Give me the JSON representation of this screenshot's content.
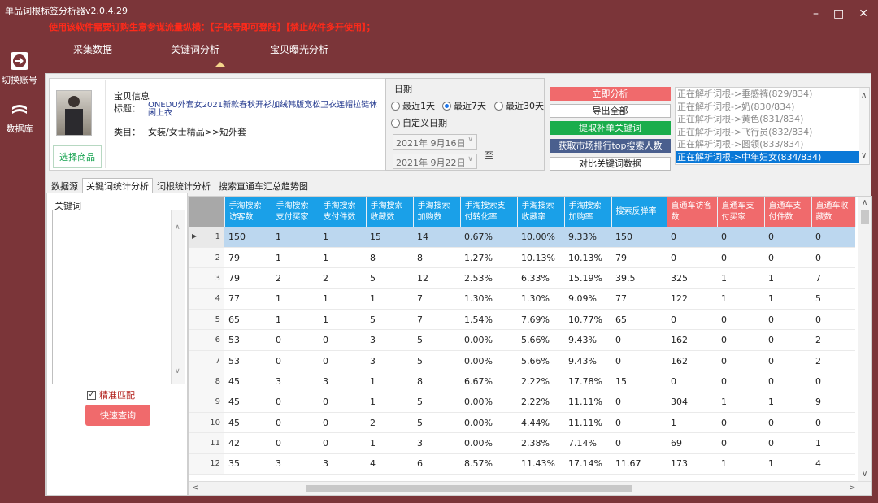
{
  "window": {
    "title": "单品词根标签分析器v2.0.4.29",
    "notice": "使用该软件需要订购生意参谋流量纵横：【子账号即可登陆】【禁止软件多开使用】；",
    "minimize": "–",
    "maximize": "□",
    "close": "✕"
  },
  "leftnav": {
    "switch_account": "切换账号",
    "database": "数据库"
  },
  "topnav": {
    "tabs": [
      "采集数据",
      "关键词分析",
      "宝贝曝光分析"
    ],
    "active": "关键词分析"
  },
  "product": {
    "section_title": "宝贝信息",
    "title_label": "标题：",
    "title_value": "ONEDU外套女2021新款春秋开衫加绒韩版宽松卫衣连帽拉链休闲上衣",
    "category_label": "类目：",
    "category_value": "女装/女士精品>>短外套",
    "pick_button": "选择商品"
  },
  "date": {
    "title": "日期",
    "options": [
      "最近1天",
      "最近7天",
      "最近30天"
    ],
    "selected": "最近7天",
    "custom": "自定义日期",
    "start": "2021年 9月16日",
    "end": "2021年 9月22日",
    "to": "至"
  },
  "actions": {
    "analyze": "立即分析",
    "export_all": "导出全部",
    "extract": "提取补单关键词",
    "market_rank": "获取市场排行top搜索人数",
    "compare": "对比关键词数据"
  },
  "log": {
    "lines": [
      "正在解析词根->垂感裤(829/834)",
      "正在解析词根->奶(830/834)",
      "正在解析词根->黄色(831/834)",
      "正在解析词根->飞行员(832/834)",
      "正在解析词根->圆领(833/834)",
      "正在解析词根->中年妇女(834/834)"
    ],
    "selected_index": 5
  },
  "subtabs": {
    "items": [
      "数据源",
      "关键词统计分析",
      "词根统计分析",
      "搜索直通车汇总趋势图"
    ],
    "active": "关键词统计分析"
  },
  "keyword_panel": {
    "legend": "关键词",
    "exact_match": "精准匹配",
    "exact_checked": true,
    "quick_search": "快速查询"
  },
  "grid": {
    "columns": [
      {
        "label": "手淘搜索访客数",
        "color": "blue"
      },
      {
        "label": "手淘搜索支付买家",
        "color": "blue"
      },
      {
        "label": "手淘搜索支付件数",
        "color": "blue"
      },
      {
        "label": "手淘搜索收藏数",
        "color": "blue"
      },
      {
        "label": "手淘搜索加购数",
        "color": "blue"
      },
      {
        "label": "手淘搜索支付转化率",
        "color": "blue"
      },
      {
        "label": "手淘搜索收藏率",
        "color": "blue"
      },
      {
        "label": "手淘搜索加购率",
        "color": "blue"
      },
      {
        "label": "搜索反弹率",
        "color": "blue"
      },
      {
        "label": "直通车访客数",
        "color": "red"
      },
      {
        "label": "直通车支付买家",
        "color": "red"
      },
      {
        "label": "直通车支付件数",
        "color": "red"
      },
      {
        "label": "直通车收藏数",
        "color": "red"
      }
    ],
    "selected_row": 0,
    "rows": [
      {
        "n": "1",
        "cells": [
          "150",
          "1",
          "1",
          "15",
          "14",
          "0.67%",
          "10.00%",
          "9.33%",
          "150",
          "0",
          "0",
          "0",
          "0"
        ]
      },
      {
        "n": "2",
        "cells": [
          "79",
          "1",
          "1",
          "8",
          "8",
          "1.27%",
          "10.13%",
          "10.13%",
          "79",
          "0",
          "0",
          "0",
          "0"
        ]
      },
      {
        "n": "3",
        "cells": [
          "79",
          "2",
          "2",
          "5",
          "12",
          "2.53%",
          "6.33%",
          "15.19%",
          "39.5",
          "325",
          "1",
          "1",
          "7"
        ]
      },
      {
        "n": "4",
        "cells": [
          "77",
          "1",
          "1",
          "1",
          "7",
          "1.30%",
          "1.30%",
          "9.09%",
          "77",
          "122",
          "1",
          "1",
          "5"
        ]
      },
      {
        "n": "5",
        "cells": [
          "65",
          "1",
          "1",
          "5",
          "7",
          "1.54%",
          "7.69%",
          "10.77%",
          "65",
          "0",
          "0",
          "0",
          "0"
        ]
      },
      {
        "n": "6",
        "cells": [
          "53",
          "0",
          "0",
          "3",
          "5",
          "0.00%",
          "5.66%",
          "9.43%",
          "0",
          "162",
          "0",
          "0",
          "2"
        ]
      },
      {
        "n": "7",
        "cells": [
          "53",
          "0",
          "0",
          "3",
          "5",
          "0.00%",
          "5.66%",
          "9.43%",
          "0",
          "162",
          "0",
          "0",
          "2"
        ]
      },
      {
        "n": "8",
        "cells": [
          "45",
          "3",
          "3",
          "1",
          "8",
          "6.67%",
          "2.22%",
          "17.78%",
          "15",
          "0",
          "0",
          "0",
          "0"
        ]
      },
      {
        "n": "9",
        "cells": [
          "45",
          "0",
          "0",
          "1",
          "5",
          "0.00%",
          "2.22%",
          "11.11%",
          "0",
          "304",
          "1",
          "1",
          "9"
        ]
      },
      {
        "n": "10",
        "cells": [
          "45",
          "0",
          "0",
          "2",
          "5",
          "0.00%",
          "4.44%",
          "11.11%",
          "0",
          "1",
          "0",
          "0",
          "0"
        ]
      },
      {
        "n": "11",
        "cells": [
          "42",
          "0",
          "0",
          "1",
          "3",
          "0.00%",
          "2.38%",
          "7.14%",
          "0",
          "69",
          "0",
          "0",
          "1"
        ]
      },
      {
        "n": "12",
        "cells": [
          "35",
          "3",
          "3",
          "4",
          "6",
          "8.57%",
          "11.43%",
          "17.14%",
          "11.67",
          "173",
          "1",
          "1",
          "4"
        ]
      }
    ]
  }
}
